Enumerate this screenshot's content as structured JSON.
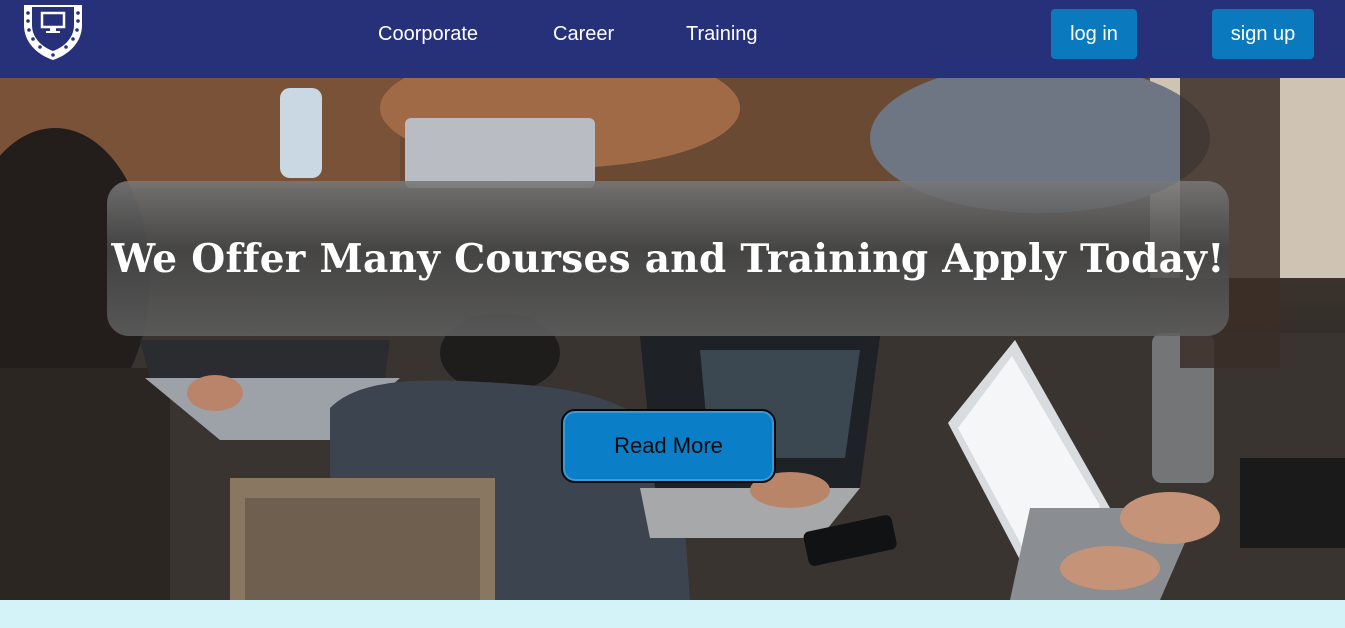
{
  "nav": {
    "links": [
      "Coorporate",
      "Career",
      "Training"
    ],
    "login_label": "log in",
    "signup_label": "sign up"
  },
  "hero": {
    "headline": "We Offer Many Courses and Training Apply Today!",
    "cta_label": "Read More"
  },
  "colors": {
    "navbar": "#27317a",
    "button": "#0b79be",
    "footer": "#d4f3f8"
  },
  "icons": {
    "logo": "shield-monitor-logo-icon"
  }
}
